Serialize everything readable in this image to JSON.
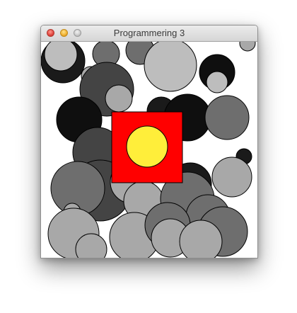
{
  "window": {
    "title": "Programmering 3",
    "buttons": [
      "close",
      "minimize",
      "zoom"
    ]
  },
  "canvas": {
    "background": "#ffffff",
    "circle_stroke": "#000000",
    "grays": [
      "#1a1a1a",
      "#444444",
      "#6e6e6e",
      "#8c8c8c",
      "#a8a8a8",
      "#bdbdbd",
      "#0f0f0f"
    ],
    "square": {
      "fill": "#ff0000",
      "stroke": "#000000"
    },
    "center_circle": {
      "fill": "#ffee3a",
      "stroke": "#000000"
    }
  }
}
